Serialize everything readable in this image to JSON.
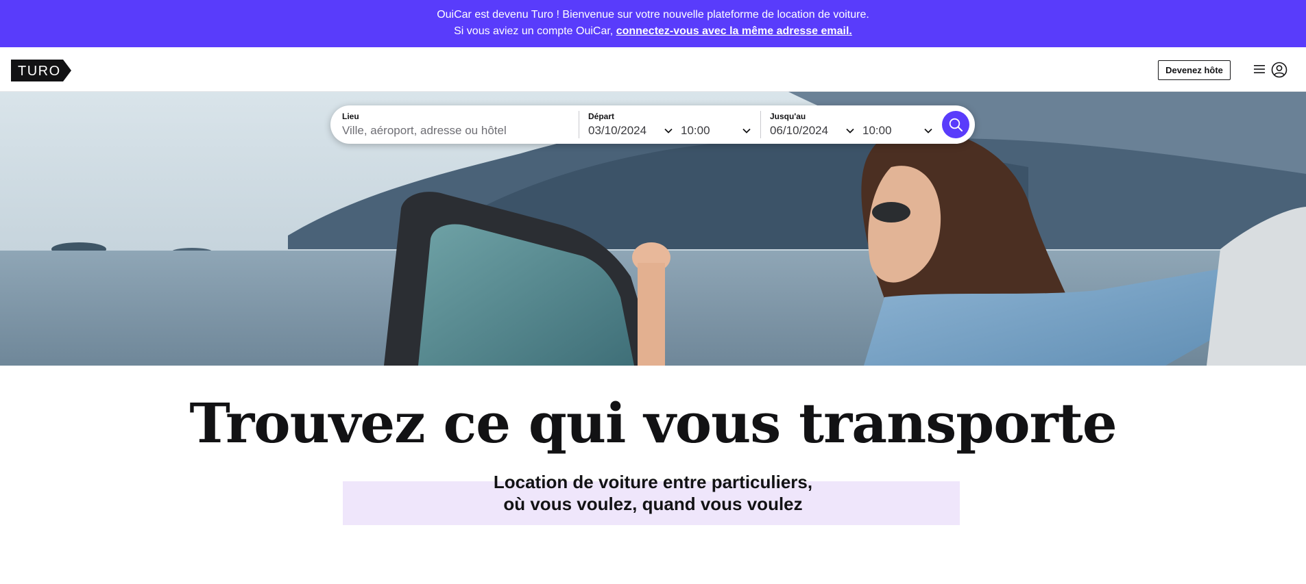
{
  "banner": {
    "line1": "OuiCar est devenu Turo ! Bienvenue sur votre nouvelle plateforme de location de voiture.",
    "line2_prefix": "Si vous aviez un compte OuiCar, ",
    "line2_link": "connectez-vous avec la même adresse email."
  },
  "header": {
    "logo_text": "TURO",
    "host_button": "Devenez hôte",
    "menu_icon": "hamburger-menu-icon",
    "user_icon": "user-avatar-icon"
  },
  "search": {
    "location_label": "Lieu",
    "location_placeholder": "Ville, aéroport, adresse ou hôtel",
    "depart_label": "Départ",
    "depart_date": "03/10/2024",
    "depart_time": "10:00",
    "return_label": "Jusqu'au",
    "return_date": "06/10/2024",
    "return_time": "10:00",
    "search_icon": "magnifier-icon"
  },
  "hero": {
    "headline": "Trouvez ce qui vous transporte",
    "subline1": "Location de voiture entre particuliers,",
    "subline2": "où vous voulez, quand vous voulez"
  },
  "colors": {
    "brand": "#593cfb",
    "highlight": "#efe6fb",
    "text": "#121214"
  }
}
